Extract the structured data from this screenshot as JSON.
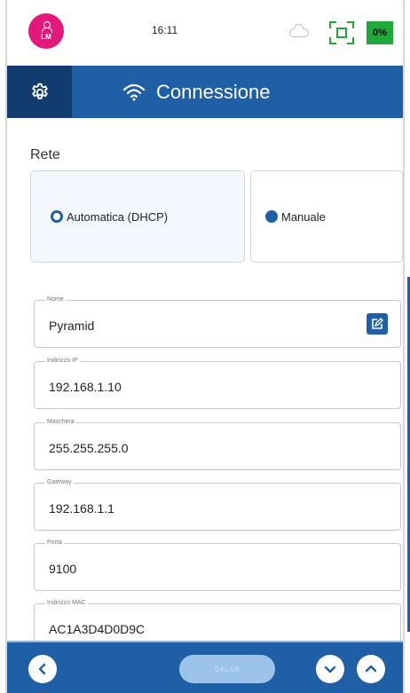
{
  "status_bar": {
    "avatar_initials": "LM",
    "time": "16:11",
    "battery": "0%",
    "icons": [
      "user-icon",
      "cloud-icon",
      "qr-scan-icon"
    ]
  },
  "header": {
    "title": "Connessione",
    "icons": [
      "gear-icon",
      "wifi-icon"
    ]
  },
  "network": {
    "label": "Rete",
    "options": [
      {
        "label": "Automatica (DHCP)",
        "selected": true
      },
      {
        "label": "Manuale",
        "selected": false
      }
    ]
  },
  "fields": [
    {
      "label": "Nome",
      "value": "Pyramid"
    },
    {
      "label": "Indirizzo IP",
      "value": "192.168.1.10"
    },
    {
      "label": "Maschera",
      "value": "255.255.255.0"
    },
    {
      "label": "Gateway",
      "value": "192.168.1.1"
    },
    {
      "label": "Porta",
      "value": "9100"
    },
    {
      "label": "Indirizzo MAC",
      "value": "AC1A3D4D0D9C"
    }
  ],
  "bottom_bar": {
    "save_label": "SALVA",
    "icons": [
      "chevron-left-icon",
      "chevron-down-icon",
      "chevron-up-icon"
    ]
  },
  "colors": {
    "primary": "#1f5fa6",
    "primary_dark": "#123b6f",
    "avatar": "#e2197a",
    "status_green": "#1fa83a"
  }
}
